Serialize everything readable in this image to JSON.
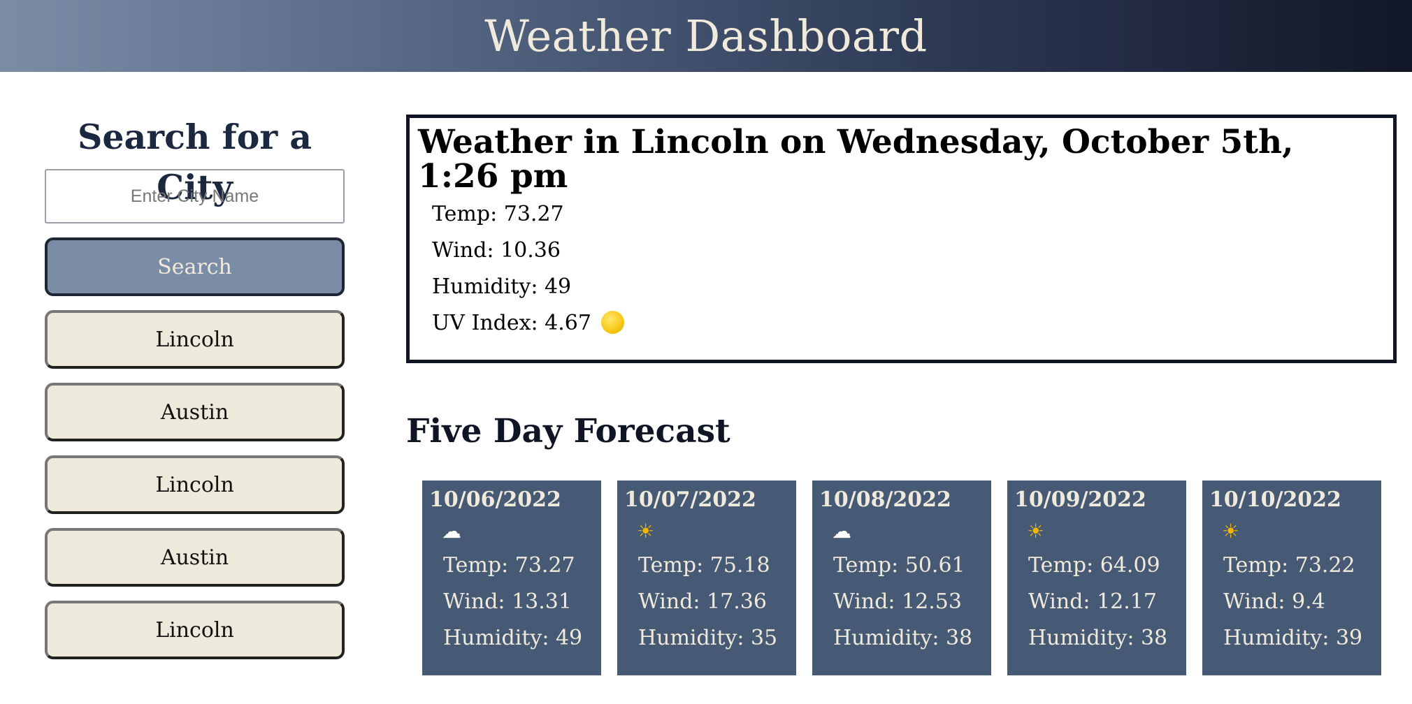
{
  "header": {
    "title": "Weather Dashboard"
  },
  "sidebar": {
    "heading": "Search for a City",
    "search_placeholder": "Enter City Name",
    "search_button": "Search",
    "history": [
      "Lincoln",
      "Austin",
      "Lincoln",
      "Austin",
      "Lincoln"
    ]
  },
  "current": {
    "title": "Weather in Lincoln on Wednesday, October 5th, 1:26 pm",
    "temp": "Temp: 73.27",
    "wind": "Wind: 10.36",
    "humidity": "Humidity: 49",
    "uv": "UV Index: 4.67",
    "uv_icon": "yellow-circle-icon",
    "uv_color": "#f7c714"
  },
  "forecast": {
    "title": "Five Day Forecast",
    "days": [
      {
        "date": "10/06/2022",
        "icon": "cloud-icon",
        "glyph": "☁",
        "temp": "Temp: 73.27",
        "wind": "Wind: 13.31",
        "humidity": "Humidity: 49"
      },
      {
        "date": "10/07/2022",
        "icon": "sun-icon",
        "glyph": "☀",
        "temp": "Temp: 75.18",
        "wind": "Wind: 17.36",
        "humidity": "Humidity: 35"
      },
      {
        "date": "10/08/2022",
        "icon": "cloud-icon",
        "glyph": "☁",
        "temp": "Temp: 50.61",
        "wind": "Wind: 12.53",
        "humidity": "Humidity: 38"
      },
      {
        "date": "10/09/2022",
        "icon": "sun-icon",
        "glyph": "☀",
        "temp": "Temp: 64.09",
        "wind": "Wind: 12.17",
        "humidity": "Humidity: 38"
      },
      {
        "date": "10/10/2022",
        "icon": "sun-icon",
        "glyph": "☀",
        "temp": "Temp: 73.22",
        "wind": "Wind: 9.4",
        "humidity": "Humidity: 39"
      }
    ]
  },
  "colors": {
    "header_gradient_start": "#7a8ca6",
    "header_gradient_end": "#111727",
    "search_button": "#7a8ca6",
    "history_button": "#eeeadb",
    "forecast_card": "#475a75",
    "text_light": "#efeadb"
  }
}
